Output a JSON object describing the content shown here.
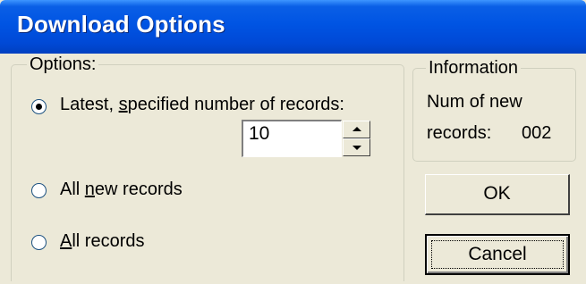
{
  "window": {
    "title": "Download Options"
  },
  "options_group": {
    "legend": "Options:",
    "radio_latest": {
      "prefix": "Latest, ",
      "accel": "s",
      "suffix": "pecified number of records:",
      "checked": true
    },
    "records_count": "10",
    "radio_all_new": {
      "prefix": "All ",
      "accel": "n",
      "suffix": "ew records",
      "checked": false
    },
    "radio_all": {
      "prefix": "",
      "accel": "A",
      "suffix": "ll records",
      "checked": false
    }
  },
  "info_group": {
    "legend": "Information",
    "line1": "Num of new",
    "line2_label": "records:",
    "line2_value": "002"
  },
  "buttons": {
    "ok": "OK",
    "cancel": "Cancel"
  },
  "icons": {
    "spin_up": "up-arrow-icon",
    "spin_down": "down-arrow-icon"
  },
  "colors": {
    "titlebar": "#0054e3",
    "background": "#ece9d8"
  }
}
